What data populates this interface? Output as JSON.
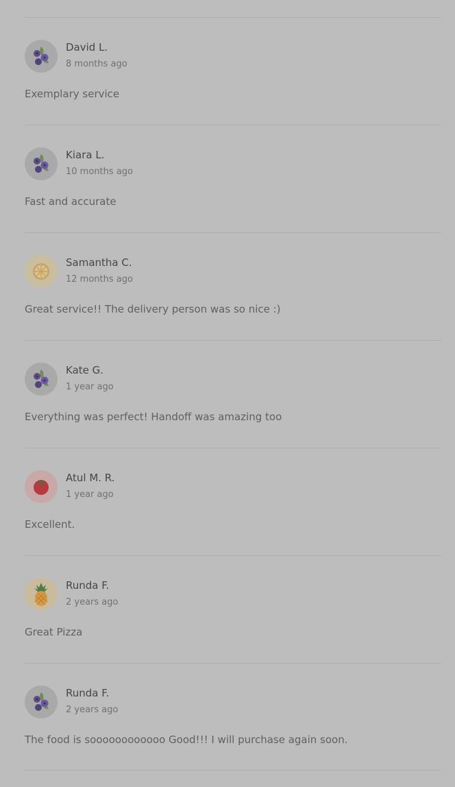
{
  "reviews": [
    {
      "name": "David L.",
      "time": "8 months ago",
      "text": "Exemplary service",
      "avatar_icon": "blueberry-icon",
      "avatar_bg": "#a9a9a9"
    },
    {
      "name": "Kiara L.",
      "time": "10 months ago",
      "text": "Fast and accurate",
      "avatar_icon": "blueberry-icon",
      "avatar_bg": "#a9a9a9"
    },
    {
      "name": "Samantha C.",
      "time": "12 months ago",
      "text": "Great service!! The delivery person was so nice :)",
      "avatar_icon": "lemon-slice-icon",
      "avatar_bg": "#c9bea0"
    },
    {
      "name": "Kate G.",
      "time": "1 year ago",
      "text": "Everything was perfect! Handoff was amazing too",
      "avatar_icon": "blueberry-icon",
      "avatar_bg": "#a9a9a9"
    },
    {
      "name": "Atul M. R.",
      "time": "1 year ago",
      "text": "Excellent.",
      "avatar_icon": "tomato-icon",
      "avatar_bg": "#c9a8a8"
    },
    {
      "name": "Runda F.",
      "time": "2 years ago",
      "text": "Great Pizza",
      "avatar_icon": "pineapple-icon",
      "avatar_bg": "#cbbb9d"
    },
    {
      "name": "Runda F.",
      "time": "2 years ago",
      "text": "The food is soooooooooooo Good!!! I will purchase again soon.",
      "avatar_icon": "blueberry-icon",
      "avatar_bg": "#a9a9a9"
    }
  ]
}
